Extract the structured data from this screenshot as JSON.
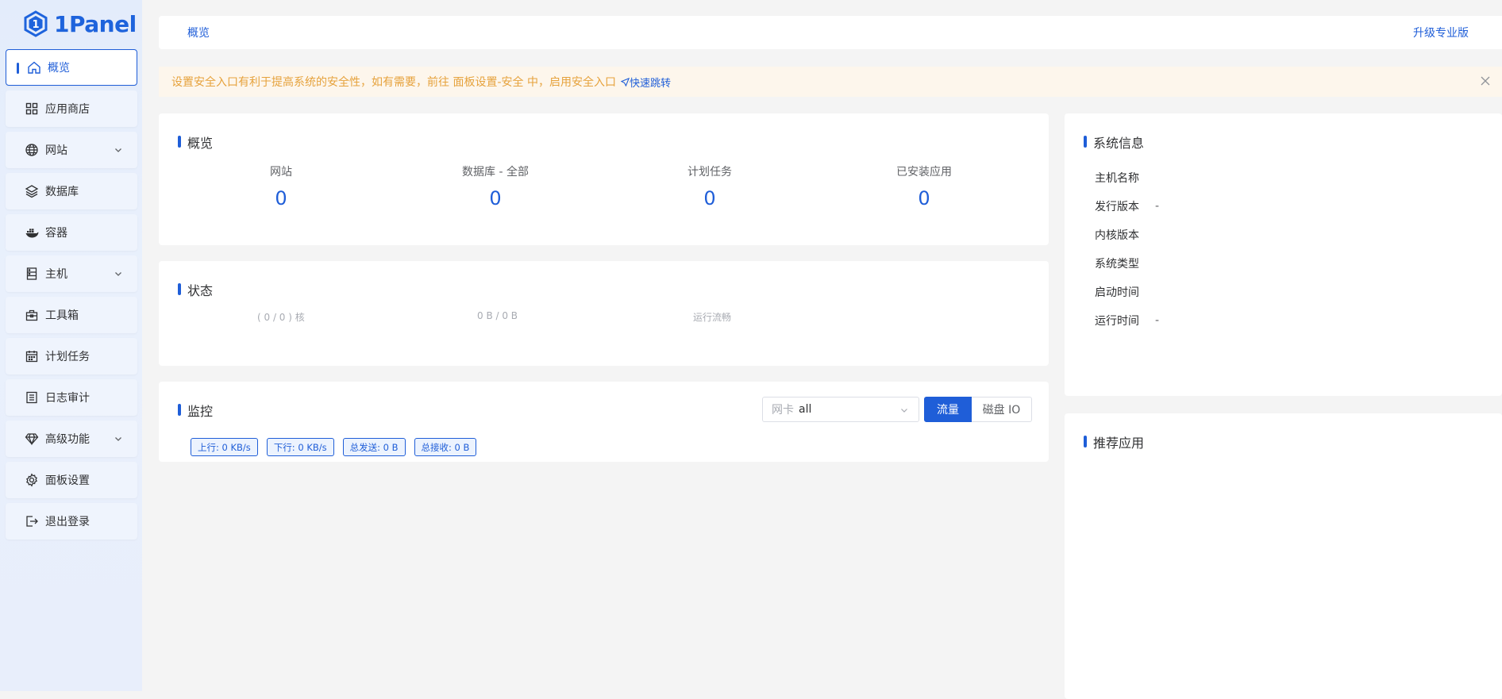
{
  "app": {
    "logo_text": "1Panel"
  },
  "sidebar": {
    "items": [
      {
        "label": "概览",
        "icon": "home-icon",
        "active": true
      },
      {
        "label": "应用商店",
        "icon": "grid-icon"
      },
      {
        "label": "网站",
        "icon": "globe-icon",
        "expandable": true
      },
      {
        "label": "数据库",
        "icon": "layers-icon"
      },
      {
        "label": "容器",
        "icon": "docker-icon"
      },
      {
        "label": "主机",
        "icon": "server-icon",
        "expandable": true
      },
      {
        "label": "工具箱",
        "icon": "toolbox-icon"
      },
      {
        "label": "计划任务",
        "icon": "calendar-icon"
      },
      {
        "label": "日志审计",
        "icon": "log-icon"
      },
      {
        "label": "高级功能",
        "icon": "diamond-icon",
        "expandable": true
      },
      {
        "label": "面板设置",
        "icon": "gear-icon"
      },
      {
        "label": "退出登录",
        "icon": "logout-icon"
      }
    ]
  },
  "header": {
    "breadcrumb": "概览",
    "upgrade": "升级专业版"
  },
  "alert": {
    "text": "设置安全入口有利于提高系统的安全性，如有需要，前往 面板设置-安全 中，启用安全入口",
    "jump": "快速跳转"
  },
  "overview": {
    "title": "概览",
    "stats": [
      {
        "label": "网站",
        "value": "0"
      },
      {
        "label": "数据库 - 全部",
        "value": "0"
      },
      {
        "label": "计划任务",
        "value": "0"
      },
      {
        "label": "已安装应用",
        "value": "0"
      }
    ]
  },
  "status": {
    "title": "状态",
    "items": [
      "( 0 / 0 ) 核",
      "0 B / 0 B",
      "运行流畅"
    ]
  },
  "monitor": {
    "title": "监控",
    "nic_prefix": "网卡",
    "nic_value": "all",
    "seg": {
      "on": "流量",
      "off": "磁盘 IO"
    },
    "tags": [
      "上行: 0 KB/s",
      "下行: 0 KB/s",
      "总发送: 0 B",
      "总接收: 0 B"
    ]
  },
  "sysinfo": {
    "title": "系统信息",
    "rows": [
      {
        "k": "主机名称",
        "v": ""
      },
      {
        "k": "发行版本",
        "v": "-"
      },
      {
        "k": "内核版本",
        "v": ""
      },
      {
        "k": "系统类型",
        "v": ""
      },
      {
        "k": "启动时间",
        "v": ""
      },
      {
        "k": "运行时间",
        "v": "-"
      }
    ]
  },
  "recommend": {
    "title": "推荐应用"
  },
  "colors": {
    "primary": "#1f5ed8",
    "warning": "#e6a23c",
    "warning_bg": "#fdf6ec"
  }
}
